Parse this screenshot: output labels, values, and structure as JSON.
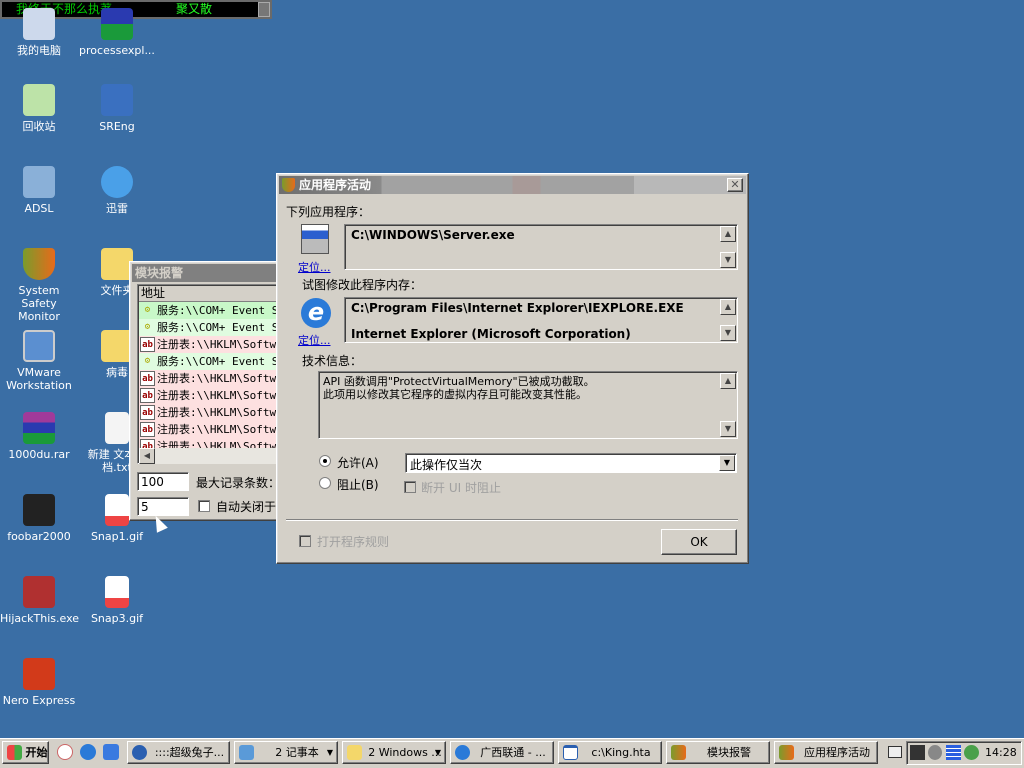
{
  "topbar": {
    "text_left": "我终于不那么执著",
    "text_right": "聚又散"
  },
  "desktop": {
    "icons": [
      {
        "label": "我的电脑"
      },
      {
        "label": "回收站"
      },
      {
        "label": "ADSL"
      },
      {
        "label": "System Safety Monitor"
      },
      {
        "label": "VMware Workstation"
      },
      {
        "label": "1000du.rar"
      },
      {
        "label": "foobar2000"
      },
      {
        "label": "HijackThis.exe"
      },
      {
        "label": "Nero Express"
      },
      {
        "label": "processexpl..."
      },
      {
        "label": "SREng"
      },
      {
        "label": "迅雷"
      },
      {
        "label": "文件夹"
      },
      {
        "label": "病毒"
      },
      {
        "label": "新建 文本文档.txt"
      },
      {
        "label": "Snap1.gif"
      },
      {
        "label": "Snap3.gif"
      }
    ]
  },
  "module_alert": {
    "title": "模块报警",
    "column_header": "地址",
    "rows": [
      {
        "type": "service",
        "text": "服务:\\\\COM+ Event Sy",
        "color": "#c8f8c8"
      },
      {
        "type": "service",
        "text": "服务:\\\\COM+ Event Sy",
        "color": "#e0fce0"
      },
      {
        "type": "registry",
        "text": "注册表:\\\\HKLM\\Softwa",
        "color": "#fde0e0"
      },
      {
        "type": "service",
        "text": "服务:\\\\COM+ Event Sy",
        "color": "#e0fce0"
      },
      {
        "type": "registry",
        "text": "注册表:\\\\HKLM\\Softwa",
        "color": "#fde0e0"
      },
      {
        "type": "registry",
        "text": "注册表:\\\\HKLM\\Softwa",
        "color": "#fde0e0"
      },
      {
        "type": "registry",
        "text": "注册表:\\\\HKLM\\Softwa",
        "color": "#fde0e0"
      },
      {
        "type": "registry",
        "text": "注册表:\\\\HKLM\\Softwa",
        "color": "#fde0e0"
      },
      {
        "type": "registry",
        "text": "注册表:\\\\HKLM\\Softwa",
        "color": "#fde0e0"
      }
    ],
    "max_records_value": "100",
    "max_records_label": "最大记录条数：",
    "auto_close_value": "5",
    "auto_close_label": "自动关闭于:"
  },
  "dialog": {
    "title": "应用程序活动",
    "app_label": "下列应用程序：",
    "app_path": "C:\\WINDOWS\\Server.exe",
    "locate": "定位...",
    "target_label": "试图修改此程序内存：",
    "target_path": "C:\\Program Files\\Internet Explorer\\IEXPLORE.EXE",
    "target_desc": "Internet Explorer (Microsoft Corporation)",
    "tech_label": "技术信息：",
    "tech_line1": "API 函数调用\"ProtectVirtualMemory\"已被成功截取。",
    "tech_line2": "此项用以修改其它程序的虚拟内存且可能改变其性能。",
    "allow_label": "允许(A)",
    "block_label": "阻止(B)",
    "selected": "allow",
    "scope_value": "此操作仅当次",
    "disconnect_label": "断开 UI 时阻止",
    "open_rules_label": "打开程序规则",
    "ok_label": "OK"
  },
  "taskbar": {
    "start": "开始",
    "tasks": [
      {
        "label": "::::超级兔子..."
      },
      {
        "label": "2 记事本"
      },
      {
        "label": "2 Windows ..."
      },
      {
        "label": "广西联通 - ..."
      },
      {
        "label": "c:\\King.hta"
      },
      {
        "label": "模块报警"
      },
      {
        "label": "应用程序活动"
      }
    ],
    "clock": "14:28"
  }
}
